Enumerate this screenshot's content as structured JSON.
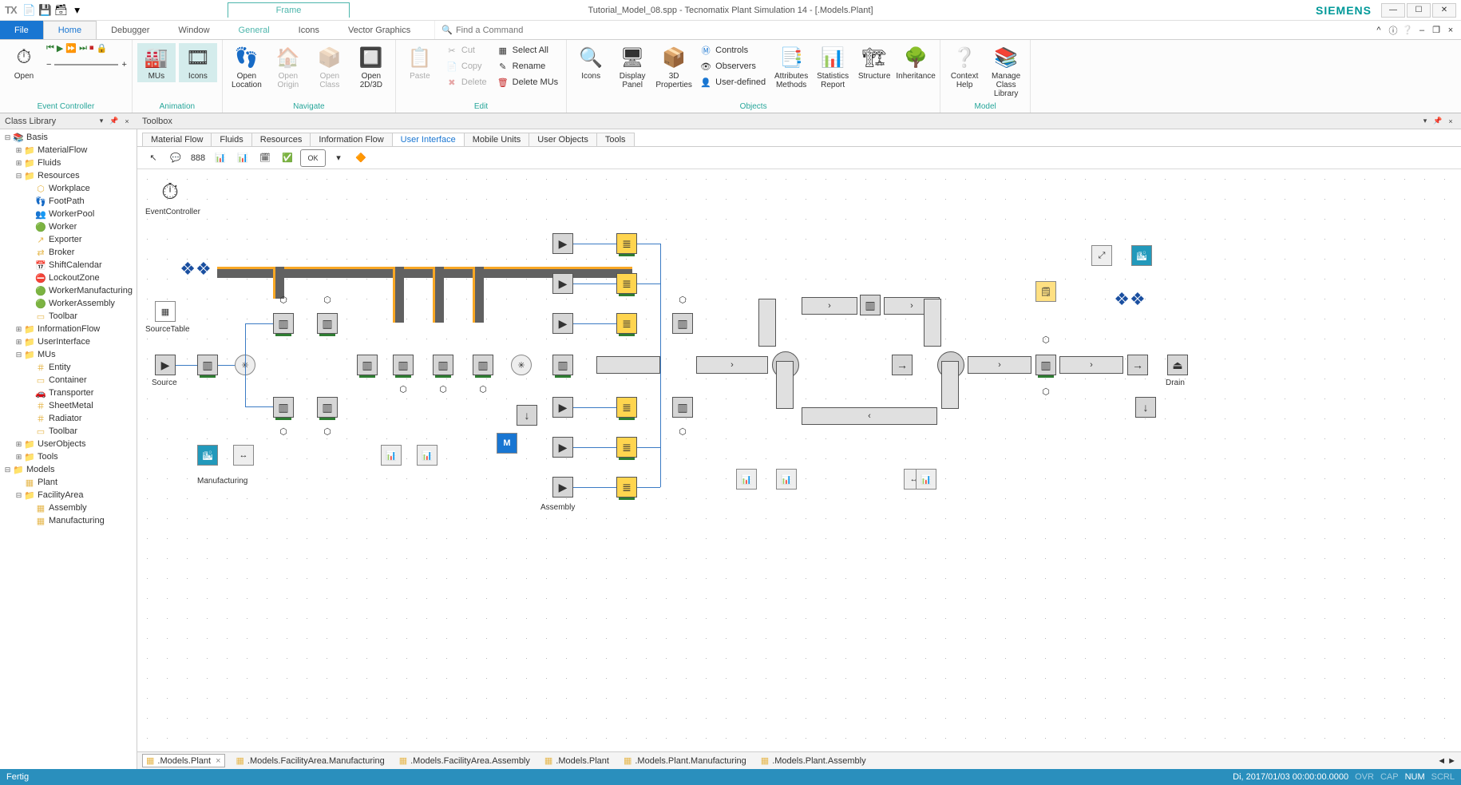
{
  "app": {
    "logo": "TX",
    "frame_tab": "Frame",
    "title": "Tutorial_Model_08.spp - Tecnomatix Plant Simulation 14 - [.Models.Plant]",
    "brand": "SIEMENS"
  },
  "qat": {
    "new": "📄",
    "save": "💾",
    "saveall": "🗃"
  },
  "win": {
    "min": "—",
    "max": "☐",
    "close": "✕"
  },
  "menu": {
    "file": "File",
    "home": "Home",
    "debugger": "Debugger",
    "window": "Window",
    "general": "General",
    "icons": "Icons",
    "vector": "Vector Graphics",
    "search_placeholder": "Find a Command"
  },
  "ribbon": {
    "ec": {
      "open": "Open",
      "label": "Event Controller"
    },
    "anim": {
      "mus": "MUs",
      "icons": "Icons",
      "label": "Animation"
    },
    "nav": {
      "openloc": "Open\nLocation",
      "openorigin": "Open\nOrigin",
      "openclass": "Open\nClass",
      "open2d3d": "Open\n2D/3D",
      "label": "Navigate"
    },
    "edit": {
      "paste": "Paste",
      "cut": "Cut",
      "copy": "Copy",
      "delete": "Delete",
      "selectall": "Select All",
      "rename": "Rename",
      "deletemus": "Delete MUs",
      "label": "Edit"
    },
    "obj": {
      "icons": "Icons",
      "display": "Display\nPanel",
      "props3d": "3D\nProperties",
      "controls": "Controls",
      "observers": "Observers",
      "userdef": "User-defined",
      "attrs": "Attributes\nMethods",
      "stats": "Statistics\nReport",
      "structure": "Structure",
      "inherit": "Inheritance",
      "label": "Objects"
    },
    "model": {
      "help": "Context\nHelp",
      "manage": "Manage\nClass Library",
      "label": "Model"
    }
  },
  "panels": {
    "classlib": "Class Library",
    "toolbox": "Toolbox"
  },
  "tree": [
    {
      "d": 0,
      "g": "-",
      "i": "📚",
      "t": "Basis"
    },
    {
      "d": 1,
      "g": "+",
      "i": "📁",
      "t": "MaterialFlow"
    },
    {
      "d": 1,
      "g": "+",
      "i": "📁",
      "t": "Fluids"
    },
    {
      "d": 1,
      "g": "-",
      "i": "📁",
      "t": "Resources"
    },
    {
      "d": 2,
      "g": " ",
      "i": "⬡",
      "t": "Workplace"
    },
    {
      "d": 2,
      "g": " ",
      "i": "👣",
      "t": "FootPath"
    },
    {
      "d": 2,
      "g": " ",
      "i": "👥",
      "t": "WorkerPool"
    },
    {
      "d": 2,
      "g": " ",
      "i": "🟢",
      "t": "Worker"
    },
    {
      "d": 2,
      "g": " ",
      "i": "↗",
      "t": "Exporter"
    },
    {
      "d": 2,
      "g": " ",
      "i": "⇄",
      "t": "Broker"
    },
    {
      "d": 2,
      "g": " ",
      "i": "📅",
      "t": "ShiftCalendar"
    },
    {
      "d": 2,
      "g": " ",
      "i": "⛔",
      "t": "LockoutZone"
    },
    {
      "d": 2,
      "g": " ",
      "i": "🟢",
      "t": "WorkerManufacturing"
    },
    {
      "d": 2,
      "g": " ",
      "i": "🟢",
      "t": "WorkerAssembly"
    },
    {
      "d": 2,
      "g": " ",
      "i": "▭",
      "t": "Toolbar"
    },
    {
      "d": 1,
      "g": "+",
      "i": "📁",
      "t": "InformationFlow"
    },
    {
      "d": 1,
      "g": "+",
      "i": "📁",
      "t": "UserInterface"
    },
    {
      "d": 1,
      "g": "-",
      "i": "📁",
      "t": "MUs"
    },
    {
      "d": 2,
      "g": " ",
      "i": "＃",
      "t": "Entity"
    },
    {
      "d": 2,
      "g": " ",
      "i": "▭",
      "t": "Container"
    },
    {
      "d": 2,
      "g": " ",
      "i": "🚗",
      "t": "Transporter"
    },
    {
      "d": 2,
      "g": " ",
      "i": "＃",
      "t": "SheetMetal"
    },
    {
      "d": 2,
      "g": " ",
      "i": "＃",
      "t": "Radiator"
    },
    {
      "d": 2,
      "g": " ",
      "i": "▭",
      "t": "Toolbar"
    },
    {
      "d": 1,
      "g": "+",
      "i": "📁",
      "t": "UserObjects"
    },
    {
      "d": 1,
      "g": "+",
      "i": "📁",
      "t": "Tools"
    },
    {
      "d": 0,
      "g": "-",
      "i": "📁",
      "t": "Models"
    },
    {
      "d": 1,
      "g": " ",
      "i": "▦",
      "t": "Plant"
    },
    {
      "d": 1,
      "g": "-",
      "i": "📁",
      "t": "FacilityArea"
    },
    {
      "d": 2,
      "g": " ",
      "i": "▦",
      "t": "Assembly"
    },
    {
      "d": 2,
      "g": " ",
      "i": "▦",
      "t": "Manufacturing"
    }
  ],
  "tbtabs": [
    "Material Flow",
    "Fluids",
    "Resources",
    "Information Flow",
    "User Interface",
    "Mobile Units",
    "User Objects",
    "Tools"
  ],
  "tbtabs_active": 4,
  "tbtools": [
    "↖",
    "💬",
    "888",
    "📊",
    "📊",
    "🗓",
    "✅",
    "OK",
    "▾",
    "🔶"
  ],
  "canvas": {
    "labels": {
      "eventcontroller": "EventController",
      "sourcetable": "SourceTable",
      "source": "Source",
      "manufacturing": "Manufacturing",
      "assembly": "Assembly",
      "drain": "Drain"
    }
  },
  "doctabs": [
    {
      "t": ".Models.Plant",
      "a": true,
      "c": true
    },
    {
      "t": ".Models.FacilityArea.Manufacturing",
      "a": false,
      "c": false
    },
    {
      "t": ".Models.FacilityArea.Assembly",
      "a": false,
      "c": false
    },
    {
      "t": ".Models.Plant",
      "a": false,
      "c": false
    },
    {
      "t": ".Models.Plant.Manufacturing",
      "a": false,
      "c": false
    },
    {
      "t": ".Models.Plant.Assembly",
      "a": false,
      "c": false
    }
  ],
  "status": {
    "left": "Fertig",
    "date": "Di, 2017/01/03 00:00:00.0000",
    "ovr": "OVR",
    "cap": "CAP",
    "num": "NUM",
    "scrl": "SCRL"
  }
}
